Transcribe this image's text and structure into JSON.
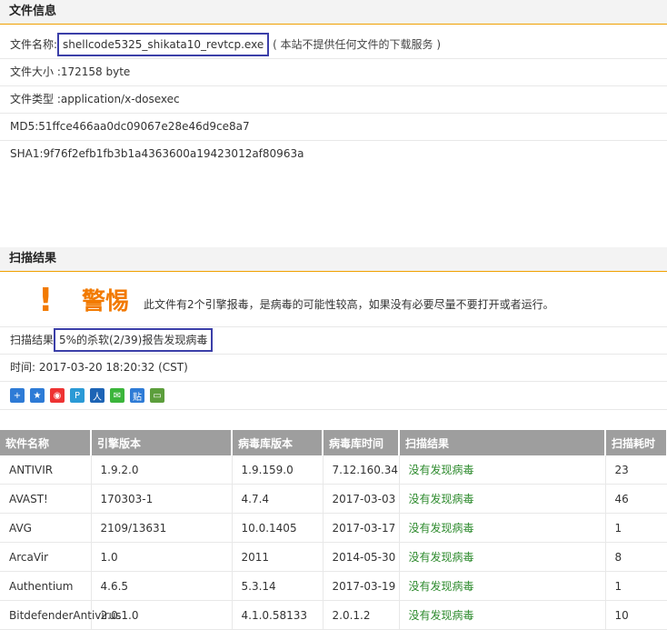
{
  "file_info": {
    "title": "文件信息",
    "name_label": "文件名称:",
    "name_value": "shellcode5325_shikata10_revtcp.exe",
    "name_note": "( 本站不提供任何文件的下载服务 )",
    "size_label": "文件大小 :",
    "size_value": "172158 byte",
    "type_label": "文件类型 :",
    "type_value": "application/x-dosexec",
    "md5": "MD5:51ffce466aa0dc09067e28e46d9ce8a7",
    "sha1": "SHA1:9f76f2efb1fb3b1a4363600a19423012af80963a"
  },
  "scan": {
    "title": "扫描结果",
    "warn_bang": "!",
    "warn_word": "警惕",
    "warn_msg": "此文件有2个引擎报毒，是病毒的可能性较高，如果没有必要尽量不要打开或者运行。",
    "result_label": "扫描结果",
    "result_value": "5%的杀软(2/39)报告发现病毒",
    "time": "时间: 2017-03-20 18:20:32 (CST)"
  },
  "share_icons": [
    {
      "name": "share-plus-icon",
      "glyph": "+",
      "color": "#2e7bd6"
    },
    {
      "name": "share-star-icon",
      "glyph": "★",
      "color": "#2e7bd6"
    },
    {
      "name": "share-weibo-icon",
      "glyph": "◉",
      "color": "#e33"
    },
    {
      "name": "share-p-icon",
      "glyph": "P",
      "color": "#2b9ad6"
    },
    {
      "name": "share-renren-icon",
      "glyph": "人",
      "color": "#1d64b5"
    },
    {
      "name": "share-wechat-icon",
      "glyph": "✉",
      "color": "#3bb53b"
    },
    {
      "name": "share-tieba-icon",
      "glyph": "贴",
      "color": "#2e7bd6"
    },
    {
      "name": "share-mail-icon",
      "glyph": "▭",
      "color": "#5c9e3c"
    }
  ],
  "table": {
    "headers": [
      "软件名称",
      "引擎版本",
      "病毒库版本",
      "病毒库时间",
      "扫描结果",
      "扫描耗时"
    ],
    "rows": [
      [
        "ANTIVIR",
        "1.9.2.0",
        "1.9.159.0",
        "7.12.160.34",
        "没有发现病毒",
        "23"
      ],
      [
        "AVAST!",
        "170303-1",
        "4.7.4",
        "2017-03-03",
        "没有发现病毒",
        "46"
      ],
      [
        "AVG",
        "2109/13631",
        "10.0.1405",
        "2017-03-17",
        "没有发现病毒",
        "1"
      ],
      [
        "ArcaVir",
        "1.0",
        "2011",
        "2014-05-30",
        "没有发现病毒",
        "8"
      ],
      [
        "Authentium",
        "4.6.5",
        "5.3.14",
        "2017-03-19",
        "没有发现病毒",
        "1"
      ],
      [
        "BitdefenderAntivirus",
        "2.0.1.0",
        "4.1.0.58133",
        "2.0.1.2",
        "没有发现病毒",
        "10"
      ]
    ]
  }
}
